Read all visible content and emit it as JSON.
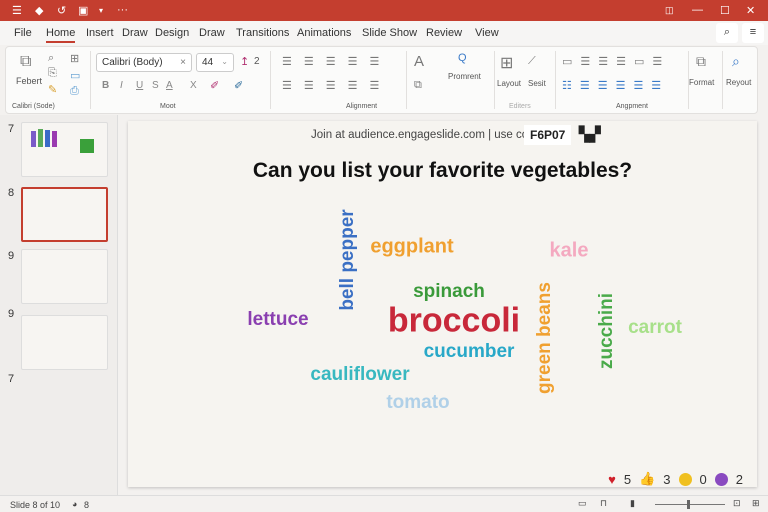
{
  "titlebar": {
    "quick_access": [
      "menu-icon",
      "save-icon",
      "undo-icon",
      "present-icon",
      "dropdown-icon",
      "more-icon"
    ],
    "controls": [
      "restore-icon",
      "minimize-icon",
      "maximize-icon",
      "close-icon"
    ]
  },
  "menu": {
    "tabs": [
      "File",
      "Home",
      "Insert",
      "Draw",
      "Design",
      "Draw",
      "Transitions",
      "Animations",
      "Slide Show",
      "Review",
      "View"
    ],
    "active": "Home"
  },
  "ribbon": {
    "paste_label": "Febert",
    "clipboard_group": "Calibri (Sode)",
    "font_name": "Calibri (Body)",
    "font_size": "44",
    "font_group": "Moot",
    "spacing_value": "2",
    "format_buttons": [
      "B",
      "I",
      "U",
      "S",
      "A",
      "X"
    ],
    "alignment_group": "Alignment",
    "prominent_label": "Promrent",
    "layout_label": "Layout",
    "sent_label": "Sesit",
    "editors_group": "Editers",
    "arrangement_group": "Angpment",
    "format_label": "Format",
    "reyout_label": "Reyout"
  },
  "sidebar": {
    "numbers": [
      "7",
      "8",
      "9",
      "9",
      "7"
    ]
  },
  "slide": {
    "join_text": "Join at audience.engageslide.com | use code",
    "code": "F6P07",
    "title": "Can you list your favorite vegetables?",
    "words": [
      {
        "text": "bell pepper",
        "color": "#3a6fc4"
      },
      {
        "text": "eggplant",
        "color": "#f0a030"
      },
      {
        "text": "kale",
        "color": "#f4a9c0"
      },
      {
        "text": "spinach",
        "color": "#3a9a3a"
      },
      {
        "text": "lettuce",
        "color": "#8a3fb0"
      },
      {
        "text": "broccoli",
        "color": "#c8283a"
      },
      {
        "text": "green beans",
        "color": "#f0a030"
      },
      {
        "text": "zucchini",
        "color": "#4aaa4a"
      },
      {
        "text": "carrot",
        "color": "#a8e08a"
      },
      {
        "text": "cucumber",
        "color": "#28a8c8"
      },
      {
        "text": "cauliflower",
        "color": "#38b8c0"
      },
      {
        "text": "tomato",
        "color": "#b0d0e8"
      }
    ],
    "reactions": [
      {
        "icon": "heart-icon",
        "count": "5"
      },
      {
        "icon": "thumbs-up-icon",
        "count": "3"
      },
      {
        "icon": "laugh-icon",
        "count": "0"
      },
      {
        "icon": "surprised-icon",
        "count": "2"
      }
    ]
  },
  "status": {
    "slide_info": "Slide 8 of 10",
    "accessibility": "8"
  }
}
